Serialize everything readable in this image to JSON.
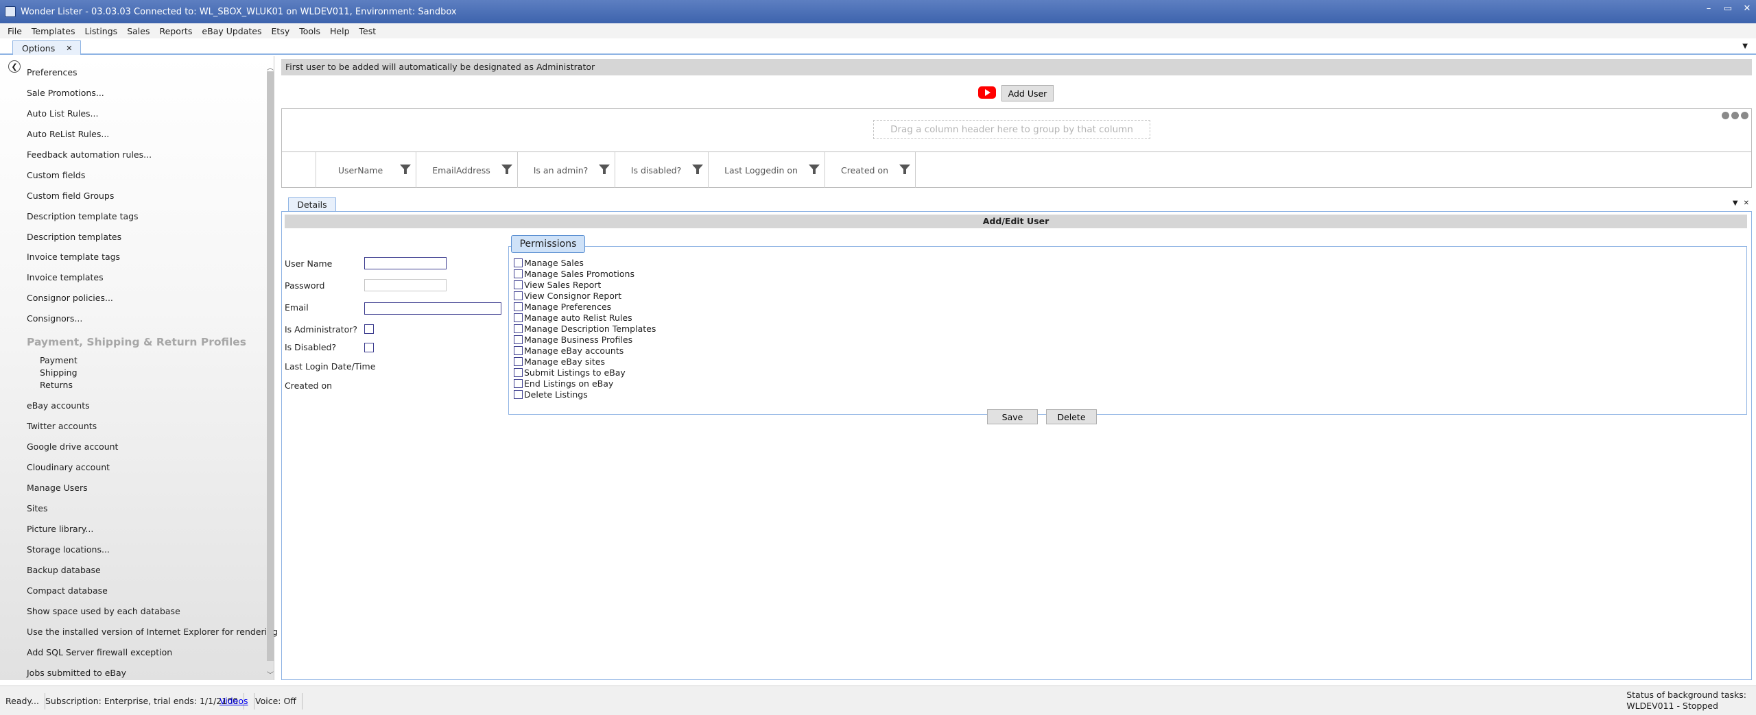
{
  "window": {
    "title": "Wonder Lister - 03.03.03 Connected to: WL_SBOX_WLUK01 on WLDEV011, Environment: Sandbox",
    "controls": [
      "–",
      "▭",
      "✕"
    ]
  },
  "menu": [
    "File",
    "Templates",
    "Listings",
    "Sales",
    "Reports",
    "eBay Updates",
    "Etsy",
    "Tools",
    "Help",
    "Test"
  ],
  "doc_tab": {
    "label": "Options",
    "close": "✕",
    "menu_glyph": "▼"
  },
  "sidebar": {
    "items": [
      "Preferences",
      "Sale Promotions...",
      "Auto List Rules...",
      "Auto ReList Rules...",
      "Feedback automation rules...",
      "Custom fields",
      "Custom field Groups",
      "Description template tags",
      "Description templates",
      "Invoice template tags",
      "Invoice templates",
      "Consignor policies...",
      "Consignors..."
    ],
    "section": "Payment, Shipping & Return Profiles",
    "sub_items": [
      "Payment",
      "Shipping",
      "Returns"
    ],
    "items_after": [
      "eBay accounts",
      "Twitter accounts",
      "Google drive account",
      "Cloudinary account",
      "Manage Users",
      "Sites",
      "Picture library...",
      "Storage locations...",
      "Backup database",
      "Compact database",
      "Show space used by each database",
      "Use the installed version of Internet Explorer for rendering HTML",
      "Add SQL Server firewall exception",
      "Jobs submitted to eBay"
    ]
  },
  "main": {
    "info_text": "First user to be added will automatically be designated as Administrator",
    "add_user_label": "Add User",
    "group_hint": "Drag a column header here to group by that column",
    "columns": [
      "UserName",
      "EmailAddress",
      "Is an admin?",
      "Is disabled?",
      "Last Loggedin on",
      "Created on"
    ]
  },
  "details": {
    "tab_label": "Details",
    "header": "Add/Edit User",
    "fields": {
      "username_label": "User Name",
      "password_label": "Password",
      "email_label": "Email",
      "is_admin_label": "Is Administrator?",
      "is_disabled_label": "Is Disabled?",
      "last_login_label": "Last Login Date/Time",
      "created_on_label": "Created on"
    },
    "permissions_title": "Permissions",
    "permissions": [
      "Manage Sales",
      "Manage Sales Promotions",
      "View Sales Report",
      "View Consignor Report",
      "Manage Preferences",
      "Manage auto Relist Rules",
      "Manage Description Templates",
      "Manage Business Profiles",
      "Manage eBay accounts",
      "Manage eBay sites",
      "Submit Listings to eBay",
      "End Listings on eBay",
      "Delete Listings"
    ],
    "save_label": "Save",
    "delete_label": "Delete"
  },
  "status": {
    "ready": "Ready...",
    "subscription": "Subscription: Enterprise, trial ends: 1/1/2100",
    "videos_link": "Videos",
    "voice": "Voice:  Off",
    "bg_tasks_line1": "Status of background tasks:",
    "bg_tasks_line2": "WLDEV011 - Stopped"
  }
}
